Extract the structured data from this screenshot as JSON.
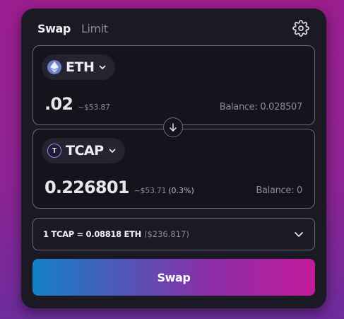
{
  "tabs": [
    {
      "label": "Swap",
      "active": true
    },
    {
      "label": "Limit",
      "active": false
    }
  ],
  "settings_icon": "gear-icon",
  "from": {
    "token_symbol": "ETH",
    "token_icon": "eth-icon",
    "amount": ".02",
    "usd_value": "~$53.87",
    "balance_label": "Balance: 0.028507"
  },
  "switch_icon": "arrow-down-icon",
  "to": {
    "token_symbol": "TCAP",
    "token_icon": "tcap-icon",
    "token_icon_letter": "T",
    "amount": "0.226801",
    "usd_value": "~$53.71",
    "price_impact": "(0.3%)",
    "balance_label": "Balance: 0"
  },
  "rate": {
    "text": "1 TCAP = 0.08818 ETH",
    "usd": "($236.817)"
  },
  "swap_button": {
    "label": "Swap"
  },
  "colors": {
    "background_top": "#9b1e8f",
    "background_bottom": "#6d2c9c",
    "card": "#1b1a24",
    "panel_border": "#6c6b78",
    "button_gradient_start": "#1281c6",
    "button_gradient_end": "#c4199a"
  }
}
